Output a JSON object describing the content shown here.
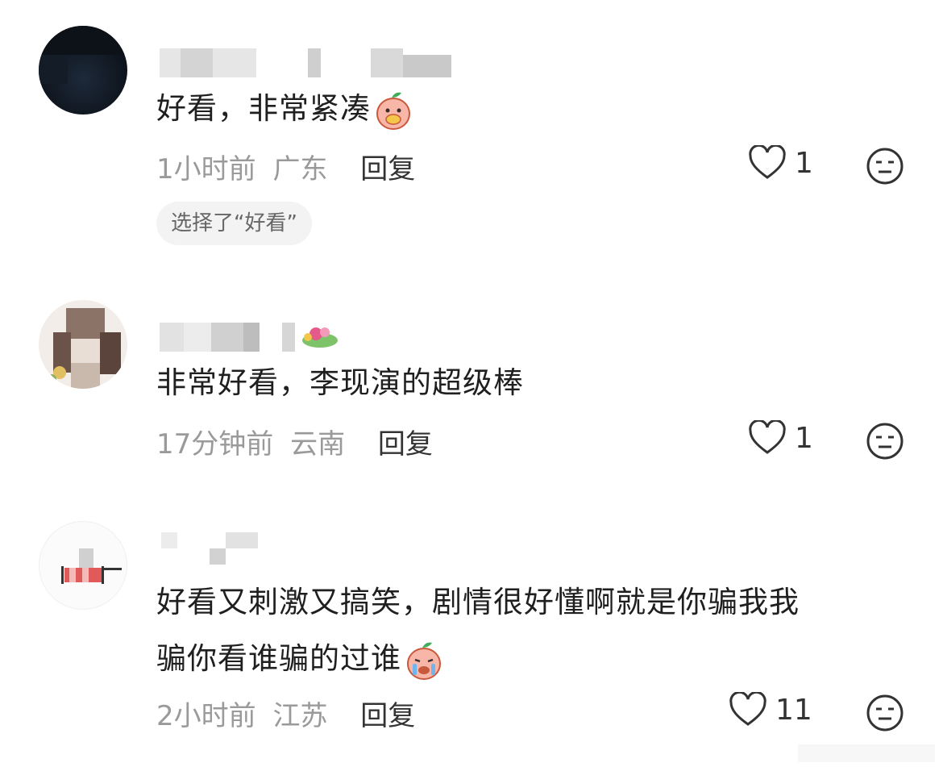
{
  "comments": [
    {
      "text": "好看，非常紧凑",
      "emoji": "peach-eating-emoji",
      "time": "1小时前",
      "location": "广东",
      "reply_label": "回复",
      "likes": "1",
      "chip": "选择了“好看”"
    },
    {
      "text": "非常好看，李现演的超级棒",
      "time": "17分钟前",
      "location": "云南",
      "reply_label": "回复",
      "likes": "1",
      "badge": "flower-badge"
    },
    {
      "text_line1": "好看又刺激又搞笑，剧情很好懂啊就是你骗我我",
      "text_line2": "骗你看谁骗的过谁",
      "emoji": "peach-crying-emoji",
      "time": "2小时前",
      "location": "江苏",
      "reply_label": "回复",
      "likes": "11"
    }
  ],
  "icons": {
    "like": "heart-outline-icon",
    "dislike": "meh-face-icon"
  },
  "colors": {
    "text": "#1f1f1f",
    "meta": "#9a9a9a",
    "chip_bg": "#f3f3f3"
  }
}
